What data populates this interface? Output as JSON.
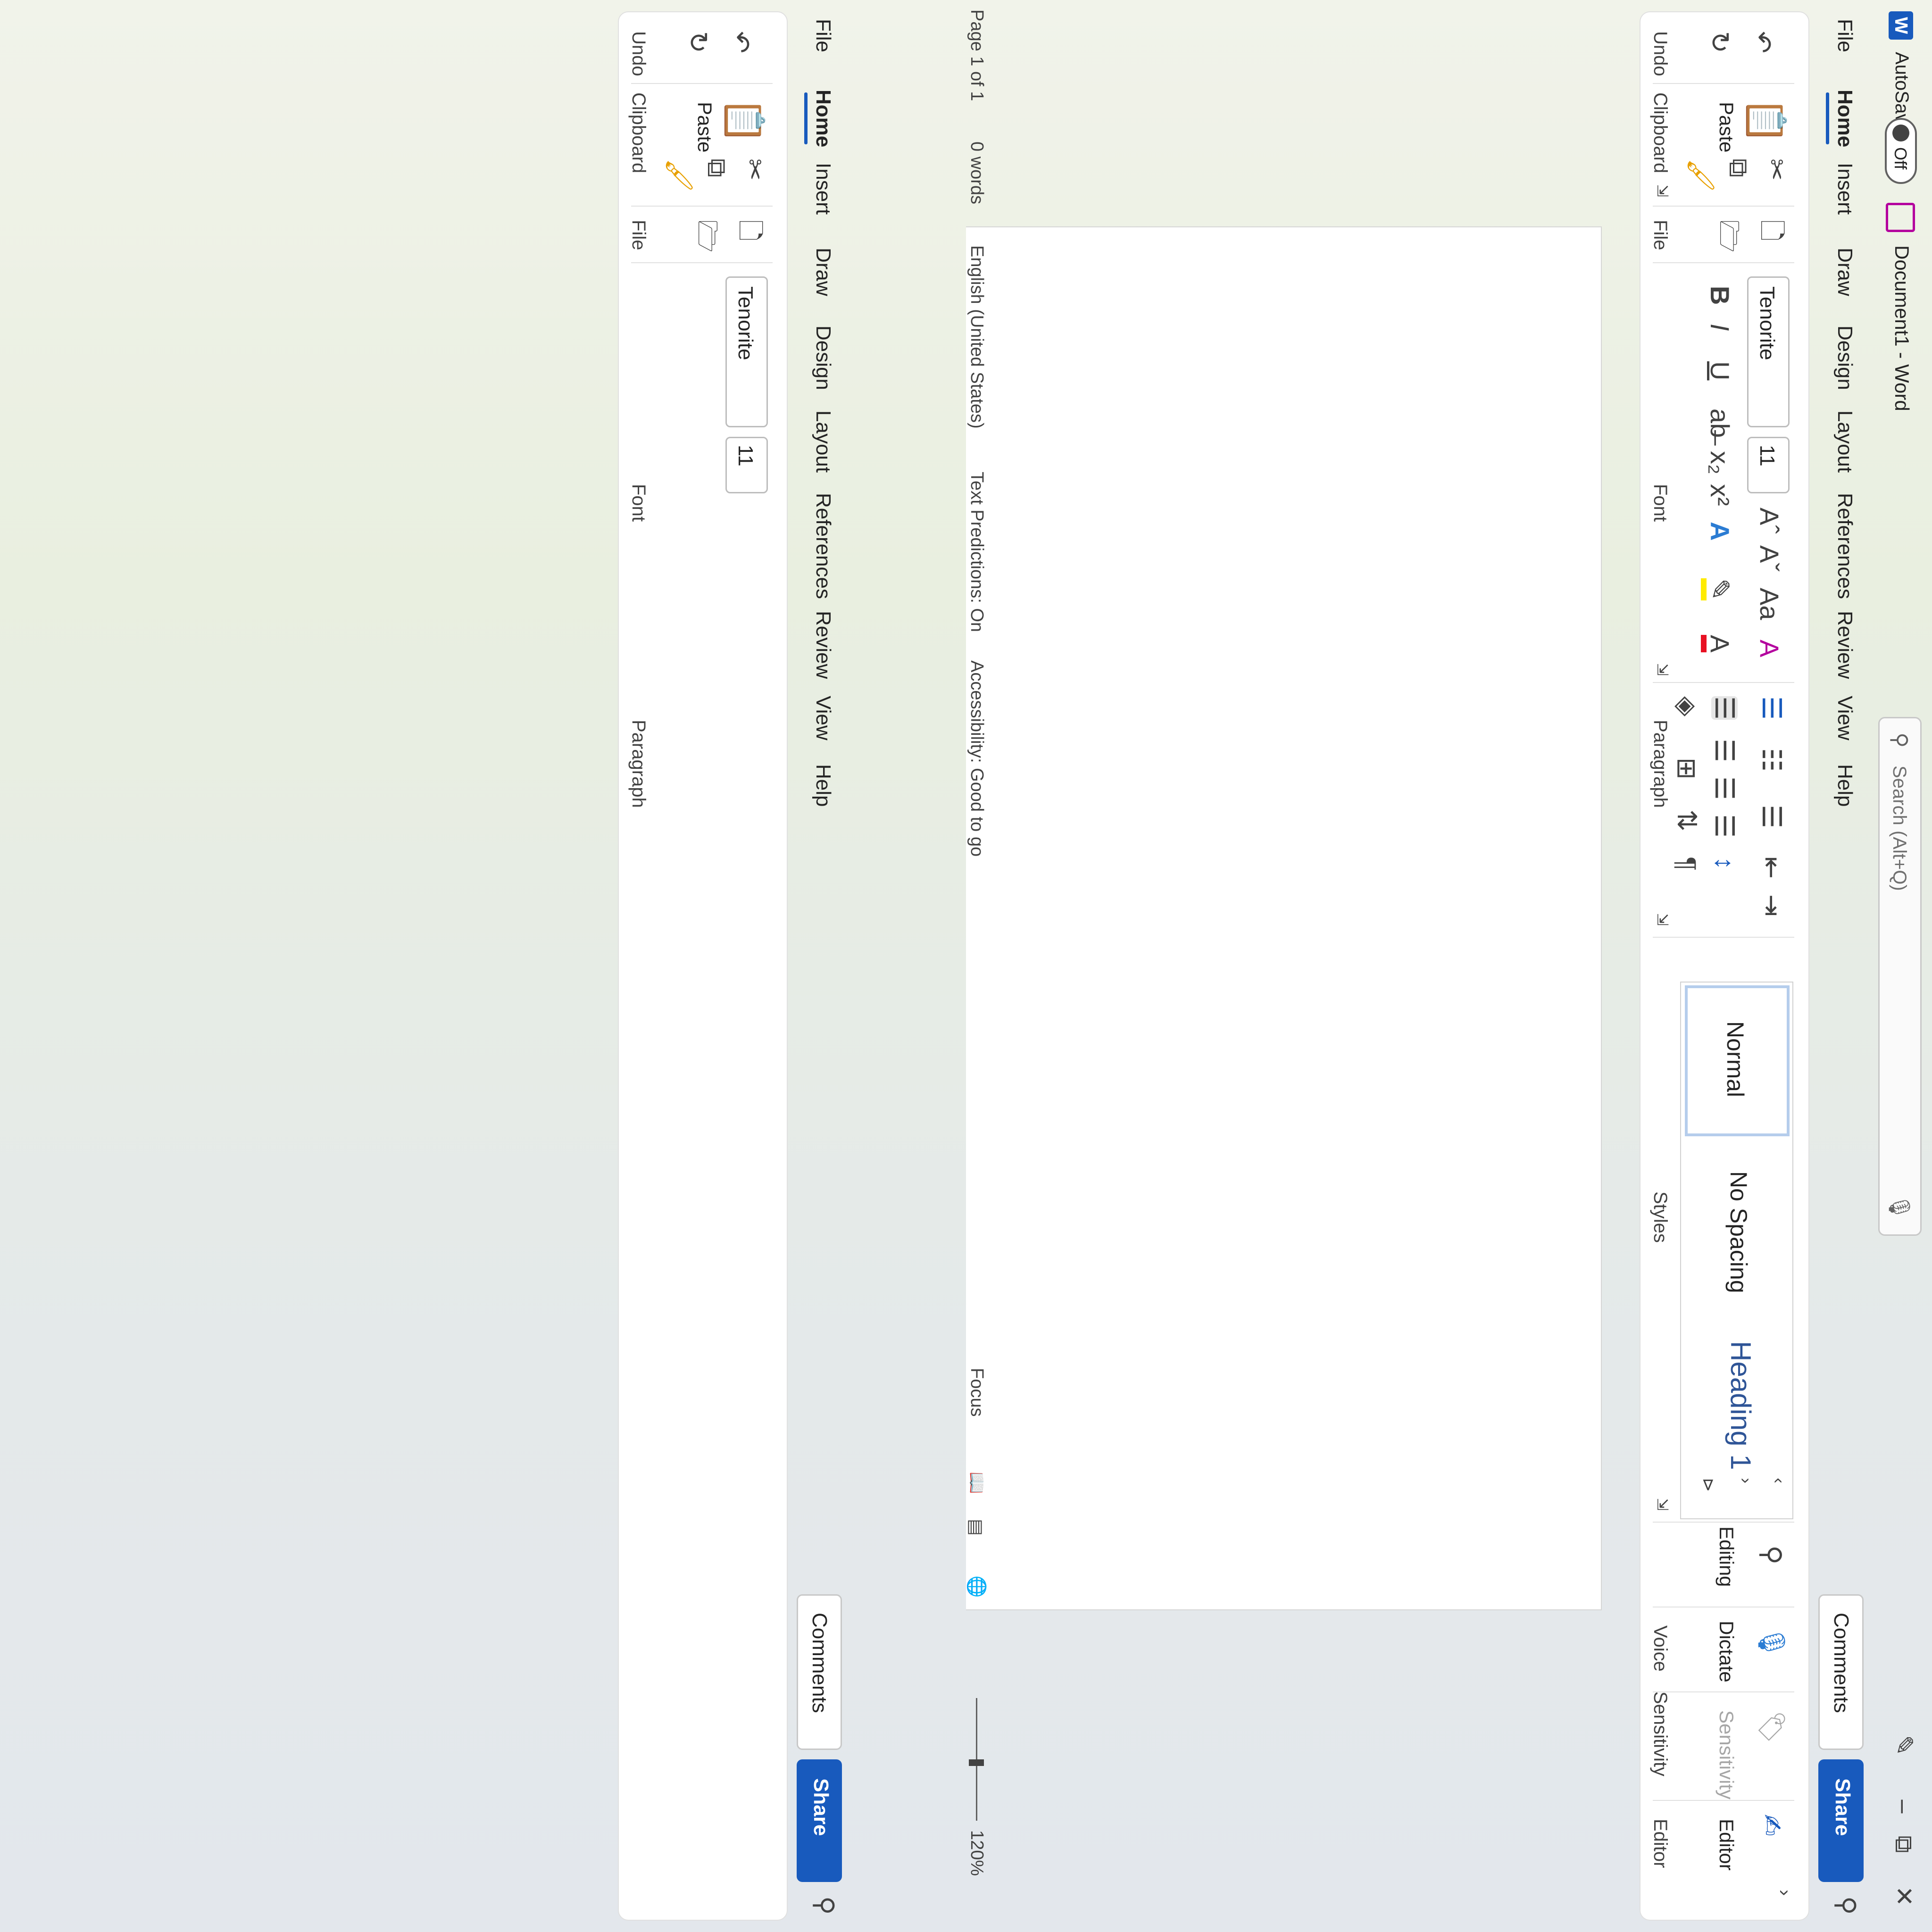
{
  "window": {
    "app_logo": "W",
    "autosave_label": "AutoSave",
    "autosave_state": "Off",
    "doc_title": "Document1 - Word",
    "search_placeholder": "Search (Alt+Q)",
    "minimize": "–",
    "restore": "⧉",
    "close": "✕"
  },
  "tabs": [
    "File",
    "Home",
    "Insert",
    "Draw",
    "Design",
    "Layout",
    "References",
    "Review",
    "View",
    "Help"
  ],
  "active_tab": "Home",
  "header_buttons": {
    "comments": "Comments",
    "share": "Share"
  },
  "ribbon": {
    "groups": {
      "undo": "Undo",
      "clipboard": "Clipboard",
      "file": "File",
      "font": "Font",
      "paragraph": "Paragraph",
      "styles": "Styles",
      "voice": "Voice",
      "sensitivity": "Sensitivity",
      "editor": "Editor"
    },
    "paste_label": "Paste",
    "font_name": "Tenorite",
    "font_size": "11",
    "styles": [
      "Normal",
      "No Spacing",
      "Heading 1"
    ],
    "editing_label": "Editing",
    "dictate_label": "Dictate",
    "sensitivity_label": "Sensitivity",
    "editor_label": "Editor",
    "colors": {
      "highlight": "#ffeb00",
      "font_color": "#e81123",
      "heading": "#2f5597",
      "accent": "#185abd"
    }
  },
  "status": {
    "page": "Page 1 of 1",
    "words": "0 words",
    "language": "English (United States)",
    "text_predictions": "Text Predictions: On",
    "accessibility": "Accessibility: Good to go",
    "focus": "Focus",
    "zoom": "120%"
  }
}
